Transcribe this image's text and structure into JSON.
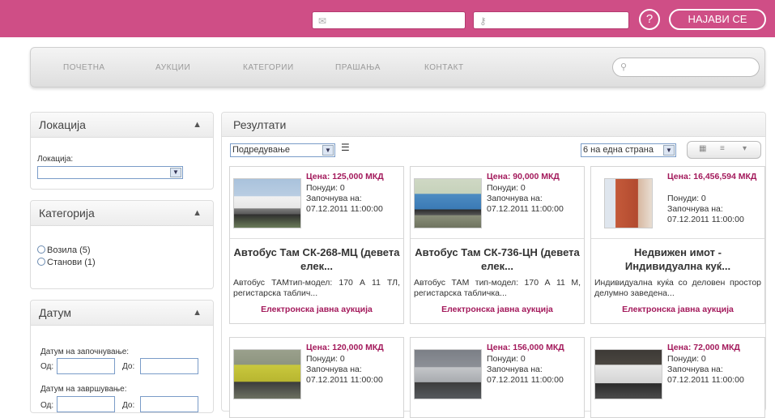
{
  "topbar": {
    "email_icon": "envelope-icon",
    "password_icon": "key-icon",
    "help_label": "?",
    "login_label": "НАЈАВИ СЕ",
    "brand_color": "#cf4e86"
  },
  "nav": {
    "items": [
      "ПОЧЕТНА",
      "АУКЦИИ",
      "КАТЕГОРИИ",
      "ПРАШАЊА",
      "КОНТАКТ"
    ],
    "search_icon": "search-icon"
  },
  "sidebar": {
    "location": {
      "title": "Локација",
      "label": "Локација:"
    },
    "category": {
      "title": "Категорија",
      "options": [
        "Возила (5)",
        "Станови (1)"
      ]
    },
    "date": {
      "title": "Датум",
      "start_label": "Датум на започнување:",
      "end_label": "Датум на завршување:",
      "from_label": "Од:",
      "to_label": "До:"
    }
  },
  "results": {
    "title": "Резултати",
    "sort_label": "Подредување",
    "per_page_label": "6 на една страна",
    "cards": [
      {
        "price": "Цена: 125,000 МКД",
        "offers": "Понуди: 0",
        "starts_label": "Започнува на:",
        "starts": "07.12.2011 11:00:00",
        "title": "Автобус Там СК-268-МЦ (девета елек...",
        "desc": "Автобус ТАМтип-модел: 170 А 11 ТЛ, регистарска таблич...",
        "type": "Електронска јавна аукција"
      },
      {
        "price": "Цена: 90,000 МКД",
        "offers": "Понуди: 0",
        "starts_label": "Започнува на:",
        "starts": "07.12.2011 11:00:00",
        "title": "Автобус Там СК-736-ЦН (девета елек...",
        "desc": "Автобус ТАМ тип-модел: 170 А 11 М, регистарска табличка...",
        "type": "Електронска јавна аукција"
      },
      {
        "price": "Цена: 16,456,594 МКД",
        "offers": "Понуди: 0",
        "starts_label": "Започнува на:",
        "starts": "07.12.2011 11:00:00",
        "title": "Недвижен имот - Индивидуална куќ...",
        "desc": "Индивидуална куќа со деловен простор делумно заведена...",
        "type": "Електронска јавна аукција"
      },
      {
        "price": "Цена: 120,000 МКД",
        "offers": "Понуди: 0",
        "starts_label": "Започнува на:",
        "starts": "07.12.2011 11:00:00"
      },
      {
        "price": "Цена: 156,000 МКД",
        "offers": "Понуди: 0",
        "starts_label": "Започнува на:",
        "starts": "07.12.2011 11:00:00"
      },
      {
        "price": "Цена: 72,000 МКД",
        "offers": "Понуди: 0",
        "starts_label": "Започнува на:",
        "starts": "07.12.2011 11:00:00"
      }
    ]
  }
}
